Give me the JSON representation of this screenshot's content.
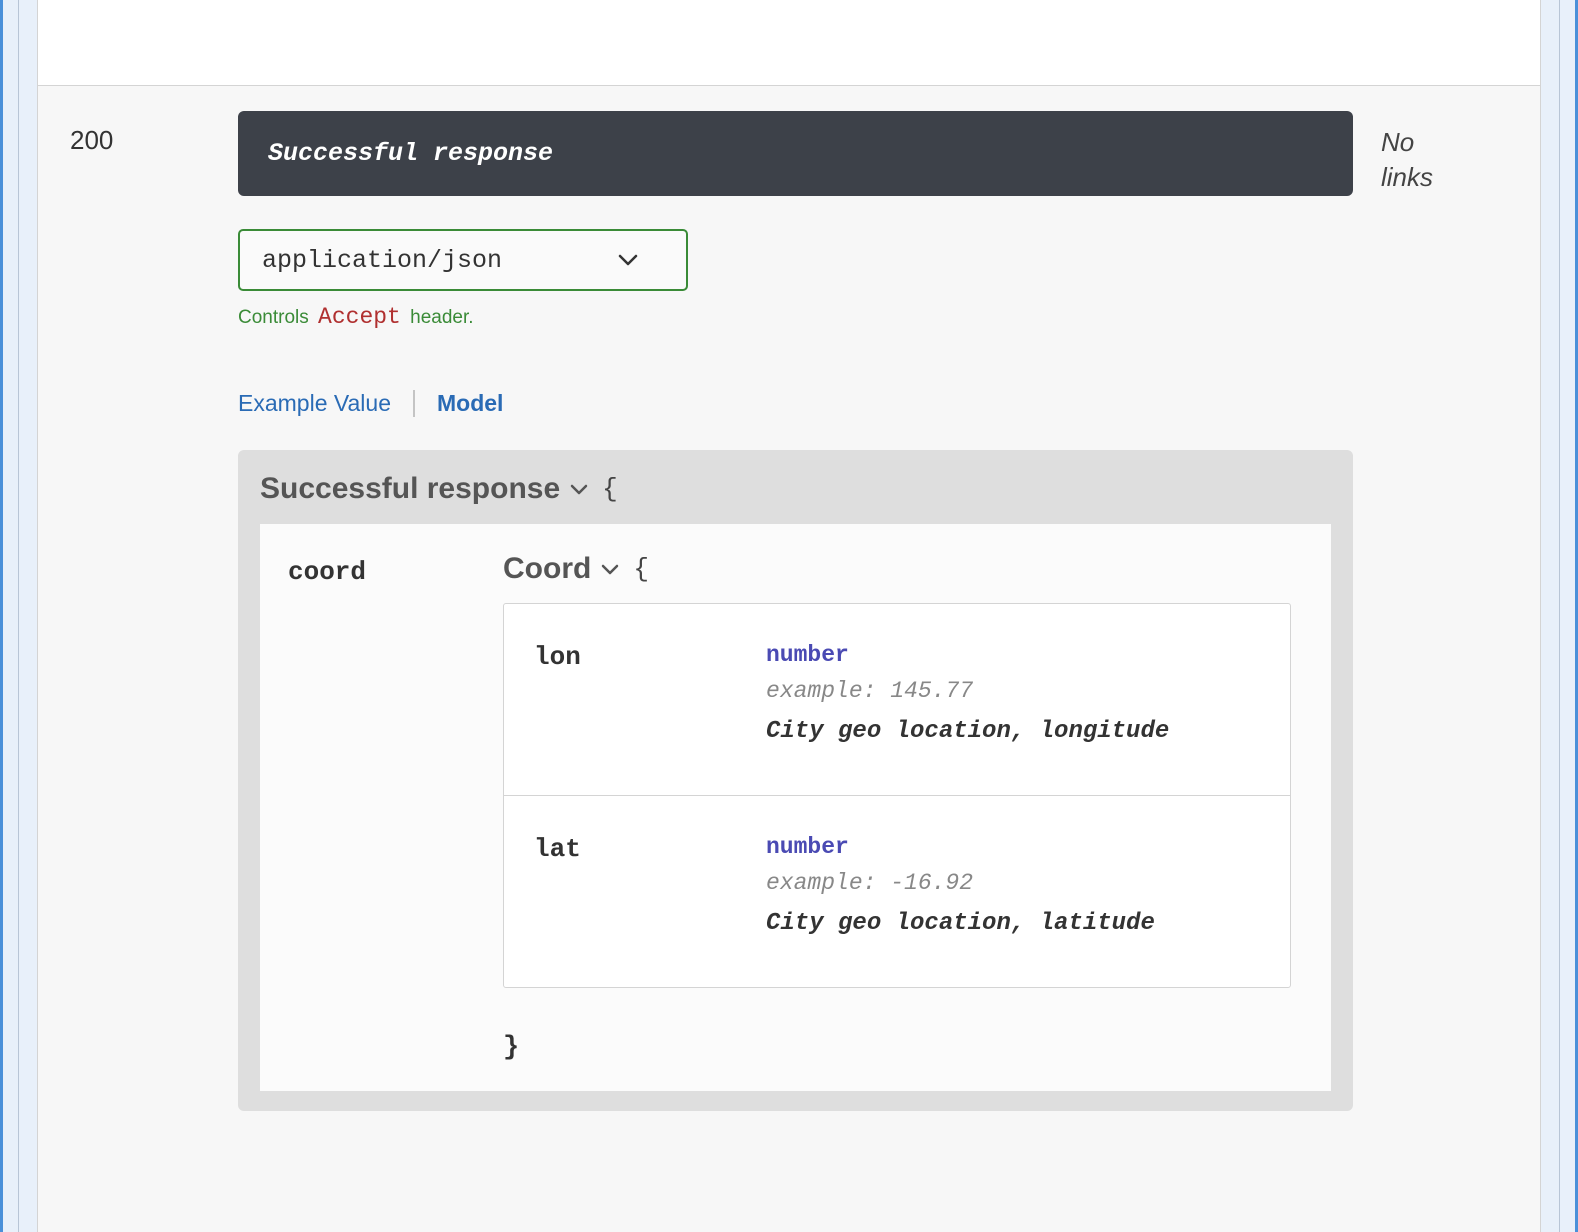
{
  "response": {
    "status_code": "200",
    "description": "Successful response",
    "links_label": "No links"
  },
  "content_type": {
    "selected": "application/json",
    "controls_prefix": "Controls",
    "controls_accept": "Accept",
    "controls_suffix": "header."
  },
  "tabs": {
    "example": "Example Value",
    "model": "Model"
  },
  "model": {
    "title": "Successful response",
    "open_brace": "{",
    "close_brace": "}",
    "props": {
      "coord": {
        "name": "coord",
        "title": "Coord",
        "open_brace": "{",
        "close_brace": "}",
        "fields": {
          "lon": {
            "name": "lon",
            "type": "number",
            "example": "example: 145.77",
            "description": "City geo location, longitude"
          },
          "lat": {
            "name": "lat",
            "type": "number",
            "example": "example: -16.92",
            "description": "City geo location, latitude"
          }
        }
      }
    }
  }
}
